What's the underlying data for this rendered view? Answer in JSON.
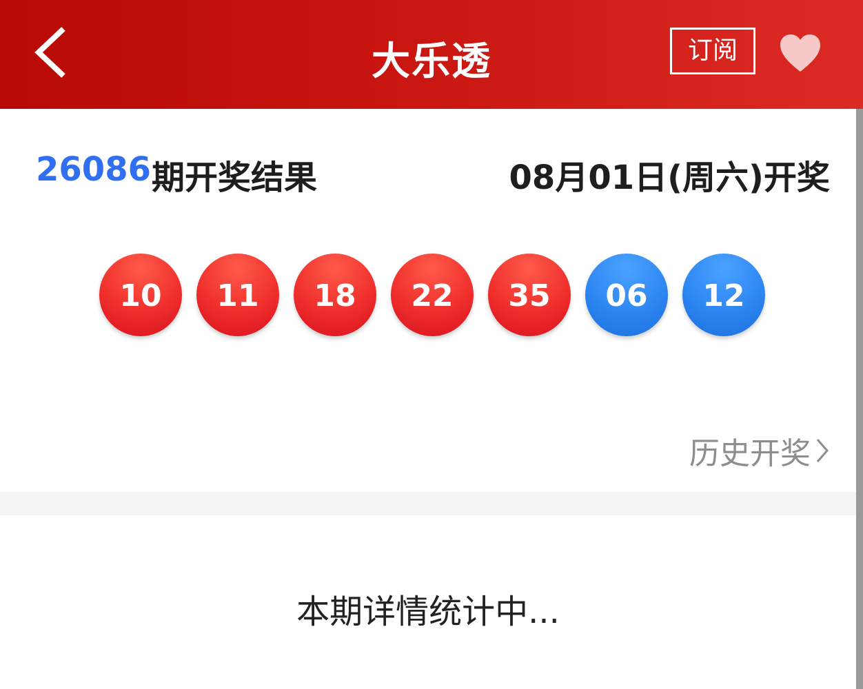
{
  "header": {
    "title": "大乐透",
    "subscribe_label": "订阅",
    "back_icon": "chevron-left-icon",
    "favorite_icon": "heart-icon"
  },
  "draw": {
    "issue_number": "26086",
    "issue_label": "期开奖结果",
    "draw_date": "08月01日(周六)开奖"
  },
  "balls": {
    "front": [
      "10",
      "11",
      "18",
      "22",
      "35"
    ],
    "back": [
      "06",
      "12"
    ],
    "front_color": "#ef2f2c",
    "back_color": "#2e86f2"
  },
  "history_link": {
    "label": "历史开奖",
    "icon": "chevron-right-icon"
  },
  "stats": {
    "status_text": "本期详情统计中..."
  },
  "colors": {
    "header_bg": "#c8150f",
    "issue_accent": "#2f6ff0"
  }
}
